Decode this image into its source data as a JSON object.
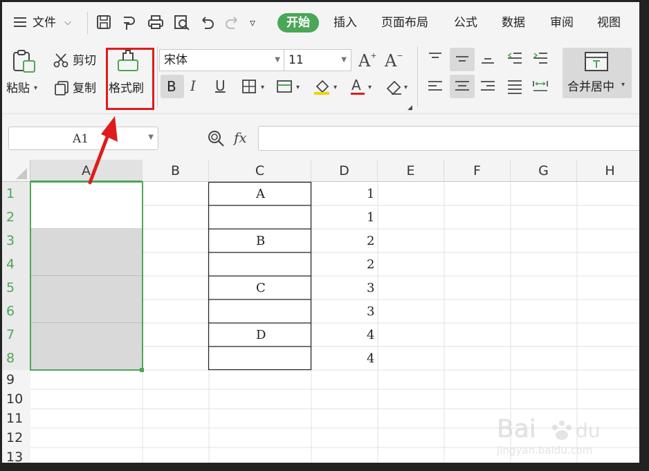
{
  "menubar": {
    "file_label": "文件",
    "tabs": [
      {
        "label": "开始",
        "active": true
      },
      {
        "label": "插入"
      },
      {
        "label": "页面布局"
      },
      {
        "label": "公式"
      },
      {
        "label": "数据"
      },
      {
        "label": "审阅"
      },
      {
        "label": "视图"
      }
    ]
  },
  "ribbon": {
    "paste_label": "粘贴",
    "cut_label": "剪切",
    "copy_label": "复制",
    "format_painter_label": "格式刷",
    "font_name": "宋体",
    "font_size": "11",
    "merge_label": "合并居中"
  },
  "formula_bar": {
    "name_box": "A1",
    "fx_label": "fx",
    "formula": ""
  },
  "columns": [
    "A",
    "B",
    "C",
    "D",
    "E",
    "F",
    "G",
    "H"
  ],
  "rows": [
    "1",
    "2",
    "3",
    "4",
    "5",
    "6",
    "7",
    "8",
    "9",
    "10",
    "11",
    "12",
    "13"
  ],
  "cells": {
    "C": [
      "A",
      "",
      "B",
      "",
      "C",
      "",
      "D",
      ""
    ],
    "D": [
      "1",
      "1",
      "2",
      "2",
      "3",
      "3",
      "4",
      "4"
    ]
  },
  "colors": {
    "accent_green": "#4aa757",
    "highlight_red": "#e01b1b",
    "merged_fill": "#d9d9d9"
  }
}
